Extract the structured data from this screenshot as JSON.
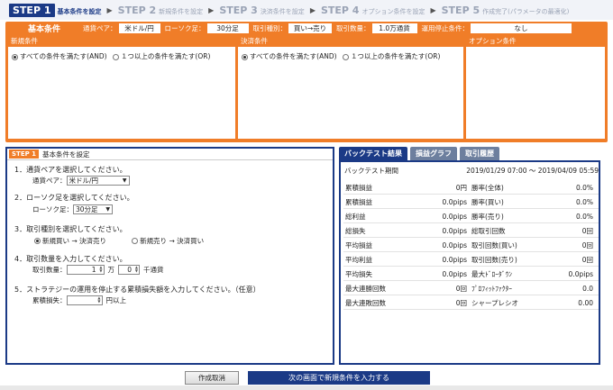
{
  "steps": [
    {
      "num": "STEP 1",
      "label": "基本条件を設定",
      "active": true
    },
    {
      "num": "STEP 2",
      "label": "新規条件を設定",
      "active": false
    },
    {
      "num": "STEP 3",
      "label": "決済条件を設定",
      "active": false
    },
    {
      "num": "STEP 4",
      "label": "オプション条件を設定",
      "active": false
    },
    {
      "num": "STEP 5",
      "label": "作成完了(パラメータの最適化)",
      "active": false
    }
  ],
  "conditions": {
    "title": "基本条件",
    "pair_label": "通貨ペア：",
    "pair_value": "米ドル/円",
    "candle_label": "ローソク足：",
    "candle_value": "30分足",
    "trade_label": "取引種別：",
    "trade_value": "買い→売り",
    "qty_label": "取引数量：",
    "qty_value": "1.0万通貨",
    "stop_label": "運用停止条件：",
    "stop_value": "なし",
    "new_title": "新規条件",
    "settle_title": "決済条件",
    "option_title": "オプション条件",
    "radio_all": "すべての条件を満たす(AND)",
    "radio_any": "１つ以上の条件を満たす(OR)"
  },
  "step1": {
    "badge": "STEP 1",
    "title": "基本条件を設定",
    "q1": "1．通貨ペアを選択してください。",
    "q1_label": "通貨ペア：",
    "q1_value": "米ドル/円",
    "q2": "2．ローソク足を選択してください。",
    "q2_label": "ローソク足：",
    "q2_value": "30分足",
    "q3": "3．取引種別を選択してください。",
    "q3_opt1": "新規買い → 決済売り",
    "q3_opt2": "新規売り → 決済買い",
    "q4": "4．取引数量を入力してください。",
    "q4_label": "取引数量：",
    "q4_value1": "1",
    "q4_unit1": "万",
    "q4_value2": "0",
    "q4_unit2": "千通貨",
    "q5": "5．ストラテジーの運用を停止する累積損失額を入力してください。（任意）",
    "q5_label": "累積損失：",
    "q5_value": "",
    "q5_unit": "円以上"
  },
  "backtest": {
    "tabs": [
      "バックテスト結果",
      "損益グラフ",
      "取引履歴"
    ],
    "period_label": "バックテスト期間",
    "period_value": "2019/01/29 07:00 ～ 2019/04/09 05:59",
    "rows": [
      [
        "累積損益",
        "0円",
        "勝率(全体)",
        "0.0%"
      ],
      [
        "累積損益",
        "0.0pips",
        "勝率(買い)",
        "0.0%"
      ],
      [
        "総利益",
        "0.0pips",
        "勝率(売り)",
        "0.0%"
      ],
      [
        "総損失",
        "0.0pips",
        "総取引回数",
        "0回"
      ],
      [
        "平均損益",
        "0.0pips",
        "取引回数(買い)",
        "0回"
      ],
      [
        "平均利益",
        "0.0pips",
        "取引回数(売り)",
        "0回"
      ],
      [
        "平均損失",
        "0.0pips",
        "最大ﾄﾞﾛｰﾀﾞｳﾝ",
        "0.0pips"
      ],
      [
        "最大連勝回数",
        "0回",
        "ﾌﾟﾛﾌｨｯﾄﾌｧｸﾀｰ",
        "0.0"
      ],
      [
        "最大連敗回数",
        "0回",
        "シャープレシオ",
        "0.00"
      ]
    ]
  },
  "buttons": {
    "cancel": "作成取消",
    "next": "次の画面で新規条件を入力する"
  }
}
